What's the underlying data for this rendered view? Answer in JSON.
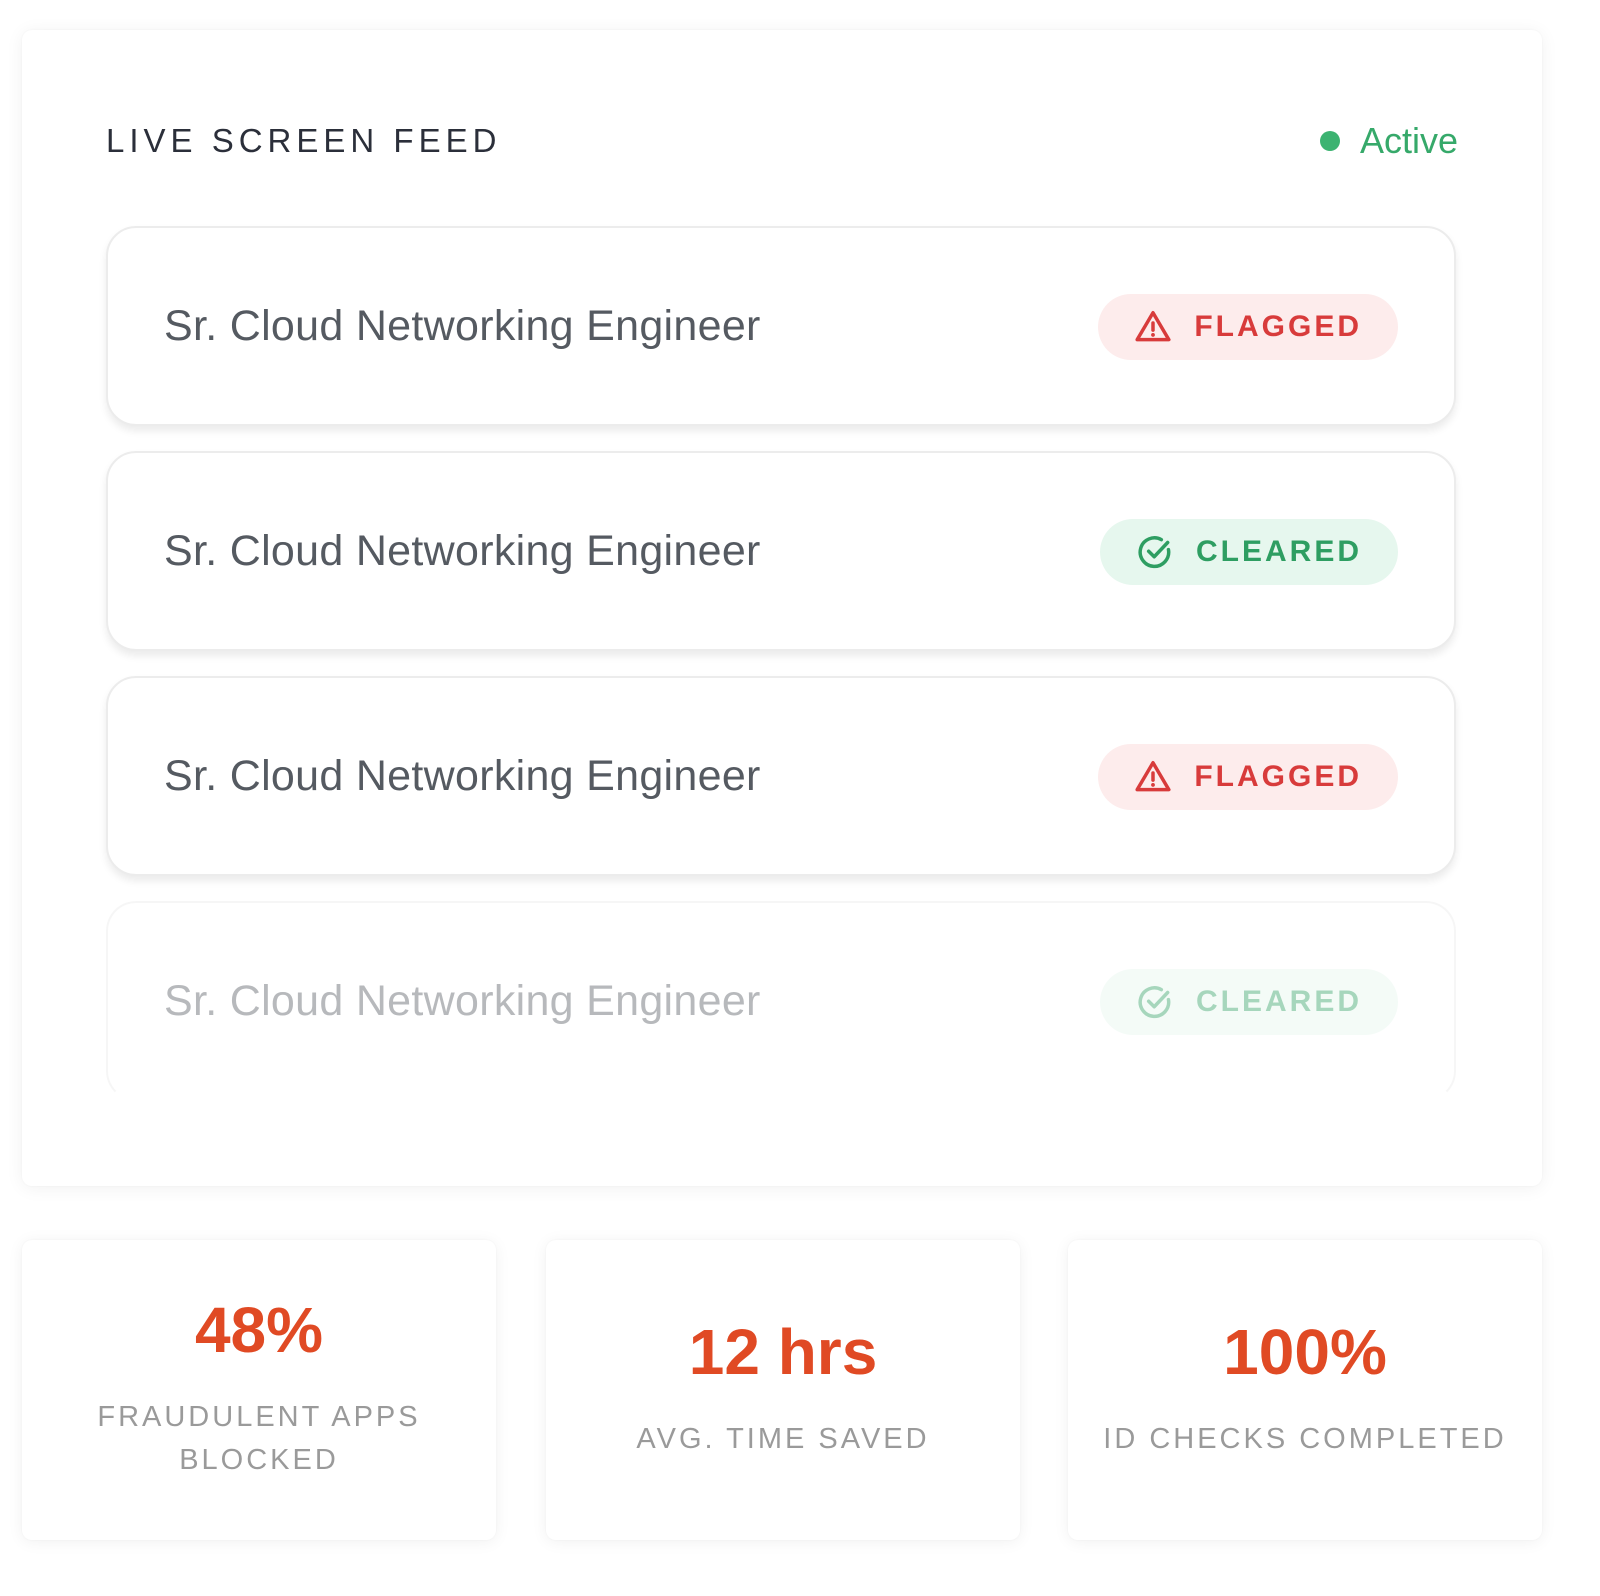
{
  "feed": {
    "title": "LIVE SCREEN FEED",
    "status_label": "Active",
    "items": [
      {
        "title": "Sr. Cloud Networking Engineer",
        "badge": "FLAGGED",
        "badge_icon": "warning-triangle-icon"
      },
      {
        "title": "Sr. Cloud Networking Engineer",
        "badge": "CLEARED",
        "badge_icon": "check-circle-icon"
      },
      {
        "title": "Sr. Cloud Networking Engineer",
        "badge": "FLAGGED",
        "badge_icon": "warning-triangle-icon"
      },
      {
        "title": "Sr. Cloud Networking Engineer",
        "badge": "CLEARED",
        "badge_icon": "check-circle-icon"
      }
    ]
  },
  "stats": [
    {
      "value": "48%",
      "label": "FRAUDULENT APPS BLOCKED"
    },
    {
      "value": "12 hrs",
      "label": "AVG. TIME SAVED"
    },
    {
      "value": "100%",
      "label": "ID CHECKS COMPLETED"
    }
  ],
  "colors": {
    "accent": "#e04a24",
    "flagged": "#d83b3b",
    "flagged_bg": "#fdecec",
    "cleared": "#2e9e62",
    "cleared_bg": "#e6f7ee",
    "active": "#3cb371"
  }
}
